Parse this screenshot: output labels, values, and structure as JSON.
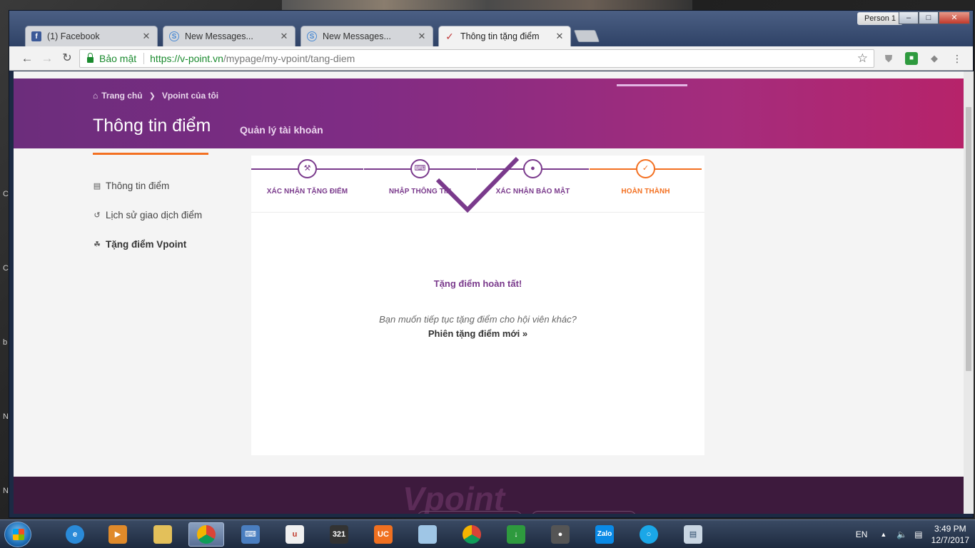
{
  "browser": {
    "person": "Person 1",
    "tabs": [
      {
        "label": "(1) Facebook",
        "icon": "facebook-icon"
      },
      {
        "label": "New Messages...",
        "icon": "skype-icon"
      },
      {
        "label": "New Messages...",
        "icon": "skype-icon"
      },
      {
        "label": "Thông tin tặng điểm",
        "icon": "vpoint-icon"
      }
    ],
    "security_label": "Bảo mật",
    "url_host": "https://v-point.vn",
    "url_path": "/mypage/my-vpoint/tang-diem"
  },
  "page": {
    "breadcrumb": {
      "home": "Trang chủ",
      "current": "Vpoint của tôi"
    },
    "title": "Thông tin điểm",
    "account_link": "Quản lý tài khoản",
    "menu": [
      {
        "label": "Thông tin điểm",
        "icon": "bar-chart-icon"
      },
      {
        "label": "Lịch sử giao dịch điểm",
        "icon": "history-icon"
      },
      {
        "label": "Tặng điểm Vpoint",
        "icon": "gift-icon"
      }
    ],
    "steps": [
      {
        "label": "XÁC NHẬN TẶNG ĐIỂM",
        "icon": "gavel-icon"
      },
      {
        "label": "NHẬP THÔNG TIN",
        "icon": "keyboard-icon"
      },
      {
        "label": "XÁC NHẬN BẢO MẬT",
        "icon": "lock-icon"
      },
      {
        "label": "HOÀN THÀNH",
        "icon": "check-icon"
      }
    ],
    "done_title": "Tặng điểm hoàn tất!",
    "continue_question": "Bạn muốn tiếp tục tặng điểm cho hội viên khác?",
    "new_session": "Phiên tặng điểm mới »",
    "footer_brand": "Vpoint"
  },
  "taskbar": {
    "language": "EN",
    "time": "3:49 PM",
    "date": "12/7/2017",
    "apps": [
      "internet-explorer",
      "media-player",
      "file-explorer",
      "chrome",
      "remote-desktop",
      "unikey",
      "media-player-classic",
      "uc-browser",
      "notepad",
      "chrome",
      "internet-download-manager",
      "microphone-app",
      "zalo",
      "cortana-app",
      "window-manager"
    ]
  },
  "colors": {
    "primary": "#7a3a8c",
    "accent": "#f37021",
    "hero_start": "#6c2d7c",
    "hero_end": "#b6236a"
  }
}
